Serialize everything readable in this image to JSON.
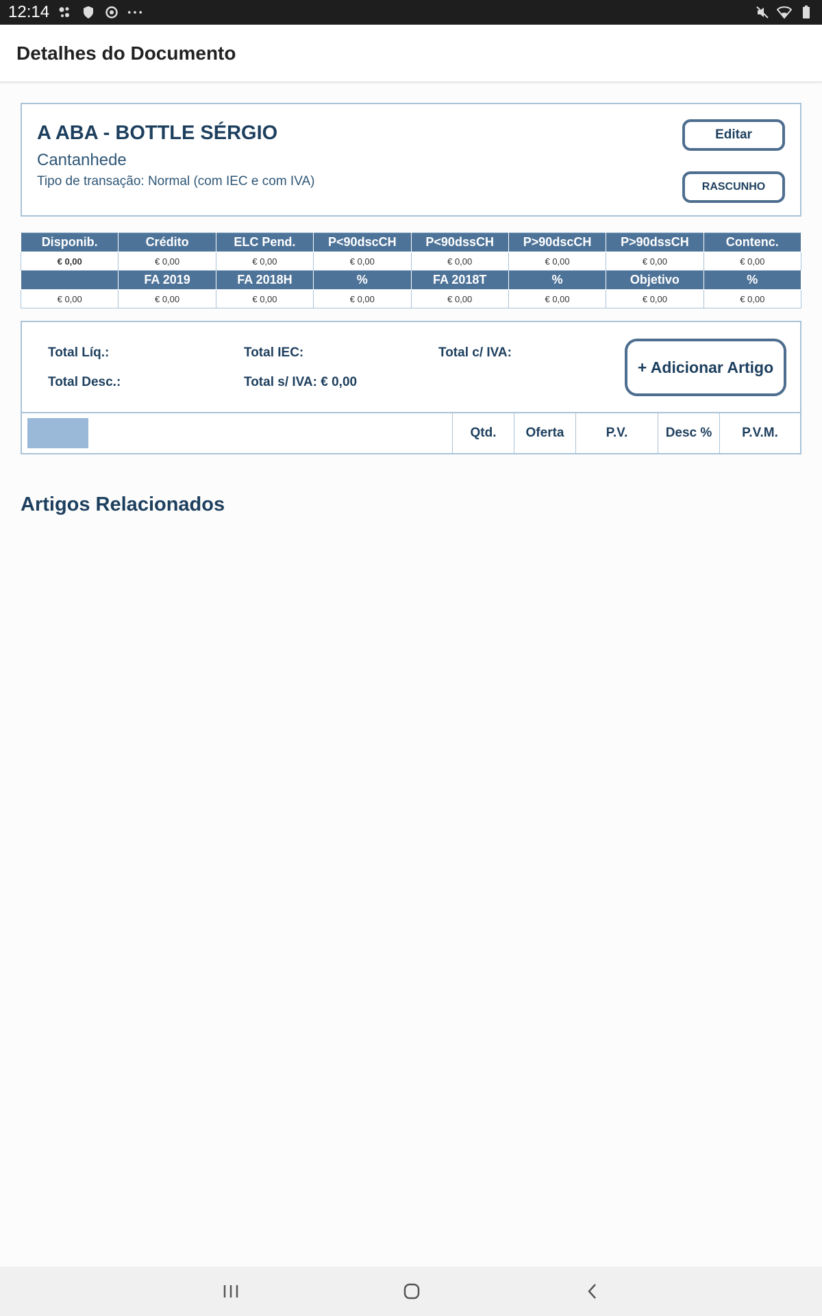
{
  "status_bar": {
    "time": "12:14"
  },
  "app_bar": {
    "title": "Detalhes do Documento"
  },
  "document": {
    "client_name": "A ABA - BOTTLE SÉRGIO",
    "city": "Cantanhede",
    "transaction_type": "Tipo de transação: Normal (com IEC e com IVA)",
    "edit_label": "Editar",
    "status_label": "RASCUNHO"
  },
  "stats": {
    "headers_1": [
      "Disponib.",
      "Crédito",
      "ELC Pend.",
      "P<90dscCH",
      "P<90dssCH",
      "P>90dscCH",
      "P>90dssCH",
      "Contenc."
    ],
    "values_1": [
      "€ 0,00",
      "€ 0,00",
      "€ 0,00",
      "€ 0,00",
      "€ 0,00",
      "€ 0,00",
      "€ 0,00",
      "€ 0,00"
    ],
    "headers_2": [
      "",
      "FA 2019",
      "FA 2018H",
      "%",
      "FA 2018T",
      "%",
      "Objetivo",
      "%"
    ],
    "values_2": [
      "€ 0,00",
      "€ 0,00",
      "€ 0,00",
      "€ 0,00",
      "€ 0,00",
      "€ 0,00",
      "€ 0,00",
      "€ 0,00"
    ],
    "highlight_color": "#e59400",
    "header_color": "#4e7398"
  },
  "totals": {
    "liquid_label": "Total Líq.:",
    "iec_label": "Total IEC:",
    "with_vat_label": "Total c/ IVA:",
    "discount_label": "Total Desc.:",
    "without_vat_label": "Total s/ IVA: € 0,00",
    "add_item_label": "+ Adicionar Artigo"
  },
  "items_table": {
    "columns": [
      "Qtd.",
      "Oferta",
      "P.V.",
      "Desc %",
      "P.V.M."
    ]
  },
  "related": {
    "title": "Artigos Relacionados"
  }
}
